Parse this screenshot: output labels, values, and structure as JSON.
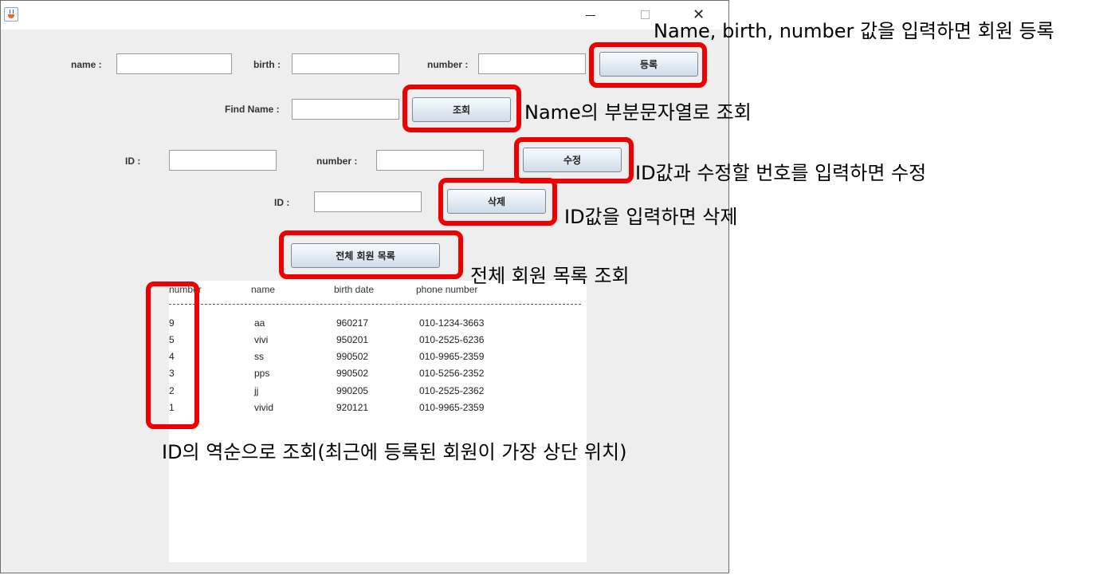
{
  "window": {
    "title": ""
  },
  "form": {
    "name_label": "name :",
    "birth_label": "birth :",
    "number_label": "number :",
    "register_button": "등록",
    "find_name_label": "Find Name :",
    "search_button": "조회",
    "update_id_label": "ID :",
    "update_number_label": "number :",
    "update_button": "수정",
    "delete_id_label": "ID :",
    "delete_button": "삭제",
    "list_all_button": "전체 회원 목록"
  },
  "table": {
    "columns": [
      "number",
      "name",
      "birth date",
      "phone number"
    ],
    "rows": [
      {
        "id": "9",
        "name": "aa",
        "birth": "960217",
        "phone": "010-1234-3663"
      },
      {
        "id": "5",
        "name": "vivi",
        "birth": "950201",
        "phone": "010-2525-6236"
      },
      {
        "id": "4",
        "name": "ss",
        "birth": "990502",
        "phone": "010-9965-2359"
      },
      {
        "id": "3",
        "name": "pps",
        "birth": "990502",
        "phone": "010-5256-2352"
      },
      {
        "id": "2",
        "name": "jj",
        "birth": "990205",
        "phone": "010-2525-2362"
      },
      {
        "id": "1",
        "name": "vivid",
        "birth": "920121",
        "phone": "010-9965-2359"
      }
    ]
  },
  "annotations": {
    "register": "Name, birth, number 값을 입력하면 회원 등록",
    "search": "Name의 부분문자열로 조회",
    "update": "ID값과 수정할 번호를 입력하면 수정",
    "delete": "ID값을 입력하면 삭제",
    "list_all": "전체 회원 목록 조회",
    "order": "ID의 역순으로 조회(최근에 등록된 회원이 가장 상단 위치)"
  },
  "colors": {
    "highlight": "#ee0000",
    "window_bg": "#eeeeee"
  }
}
